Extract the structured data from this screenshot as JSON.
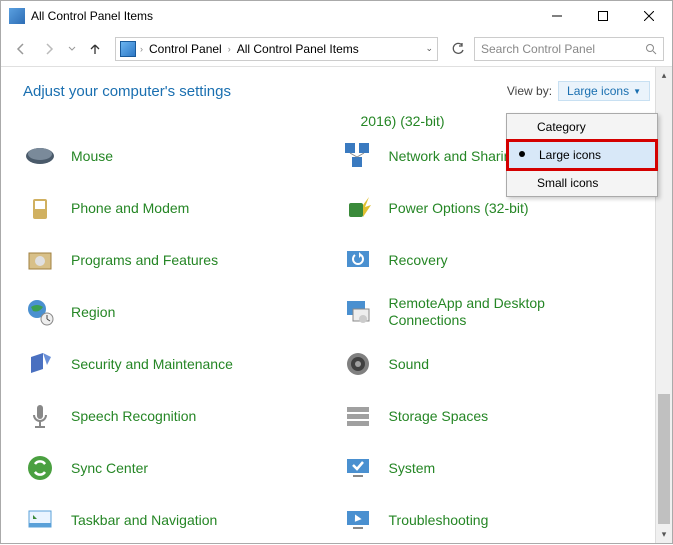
{
  "window": {
    "title": "All Control Panel Items"
  },
  "breadcrumb": {
    "root": "Control Panel",
    "current": "All Control Panel Items"
  },
  "search": {
    "placeholder": "Search Control Panel"
  },
  "heading": "Adjust your computer's settings",
  "viewby": {
    "label": "View by:",
    "selected": "Large icons"
  },
  "dropdown": {
    "items": [
      "Category",
      "Large icons",
      "Small icons"
    ],
    "selected_index": 1
  },
  "cut_text": "2016) (32-bit)",
  "items_left": [
    "Mouse",
    "Phone and Modem",
    "Programs and Features",
    "Region",
    "Security and Maintenance",
    "Speech Recognition",
    "Sync Center",
    "Taskbar and Navigation"
  ],
  "items_right": [
    "Network and Sharing Center",
    "Power Options (32-bit)",
    "Recovery",
    "RemoteApp and Desktop Connections",
    "Sound",
    "Storage Spaces",
    "System",
    "Troubleshooting"
  ]
}
